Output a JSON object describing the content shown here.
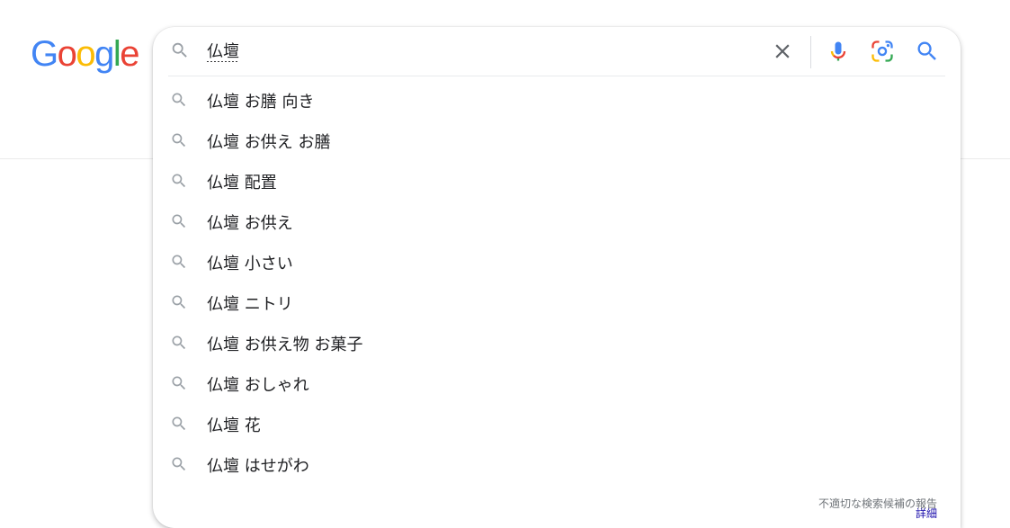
{
  "logo": {
    "letters": [
      "G",
      "o",
      "o",
      "g",
      "l",
      "e"
    ],
    "colors": [
      "#4285F4",
      "#EA4335",
      "#FBBC05",
      "#4285F4",
      "#34A853",
      "#EA4335"
    ]
  },
  "search": {
    "query": "仏壇",
    "leading_icon": "search-icon",
    "clear_icon": "close-icon",
    "voice_icon": "microphone-icon",
    "lens_icon": "camera-lens-icon",
    "submit_icon": "search-icon"
  },
  "suggestions": [
    {
      "text": "仏壇 お膳 向き"
    },
    {
      "text": "仏壇 お供え お膳"
    },
    {
      "text": "仏壇 配置"
    },
    {
      "text": "仏壇 お供え"
    },
    {
      "text": "仏壇 小さい"
    },
    {
      "text": "仏壇 ニトリ"
    },
    {
      "text": "仏壇 お供え物 お菓子"
    },
    {
      "text": "仏壇 おしゃれ"
    },
    {
      "text": "仏壇 花"
    },
    {
      "text": "仏壇 はせがわ"
    }
  ],
  "footer": {
    "report_label": "不適切な検索候補の報告",
    "details_label": "詳細"
  },
  "colors": {
    "text": "#202124",
    "icon_gray": "#9aa0a6",
    "accent_blue": "#4285F4",
    "link_blue": "#1a0dab"
  }
}
